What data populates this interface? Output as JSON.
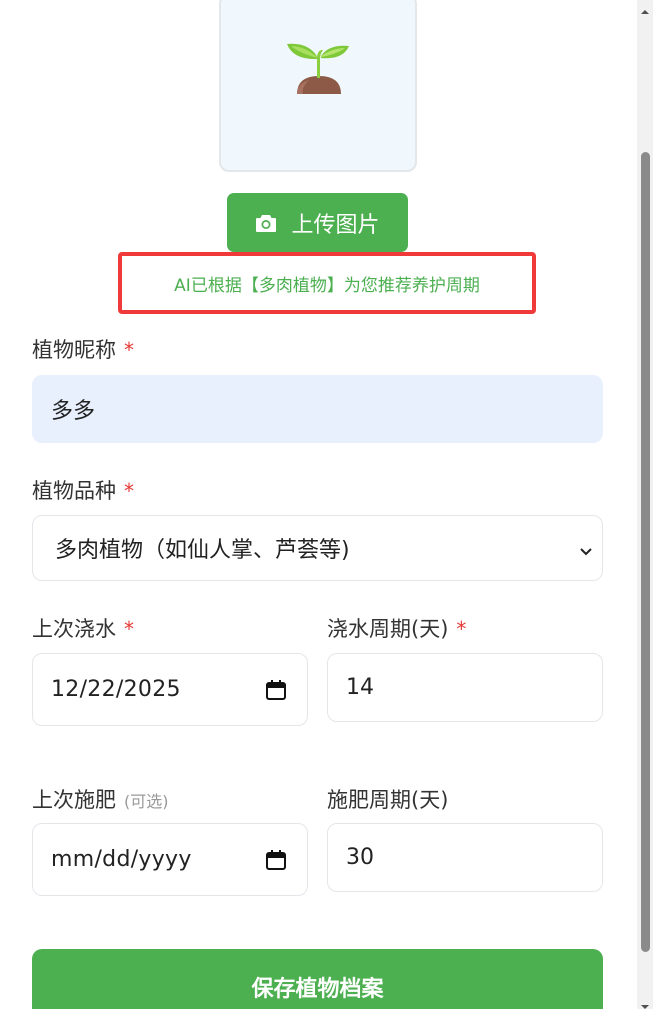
{
  "upload": {
    "label": "上传图片",
    "icon": "camera-icon"
  },
  "preview": {
    "icon": "sprout-icon"
  },
  "ai_tip": "AI已根据【多肉植物】为您推荐养护周期",
  "nickname": {
    "label": "植物昵称",
    "required_mark": "*",
    "value": "多多"
  },
  "species": {
    "label": "植物品种",
    "required_mark": "*",
    "selected": "多肉植物（如仙人掌、芦荟等)"
  },
  "last_watering": {
    "label": "上次浇水",
    "required_mark": "*",
    "value": "12/22/2025"
  },
  "water_cycle": {
    "label": "浇水周期(天)",
    "required_mark": "*",
    "value": "14"
  },
  "last_fertilize": {
    "label": "上次施肥",
    "optional_note": "(可选)",
    "placeholder": "mm/dd/yyyy"
  },
  "fertilize_cycle": {
    "label": "施肥周期(天)",
    "value": "30"
  },
  "save_button": "保存植物档案",
  "colors": {
    "accent": "#4caf50",
    "highlight_border": "#f03a3a",
    "required": "#e53935",
    "filled_bg": "#e8f0fd"
  }
}
